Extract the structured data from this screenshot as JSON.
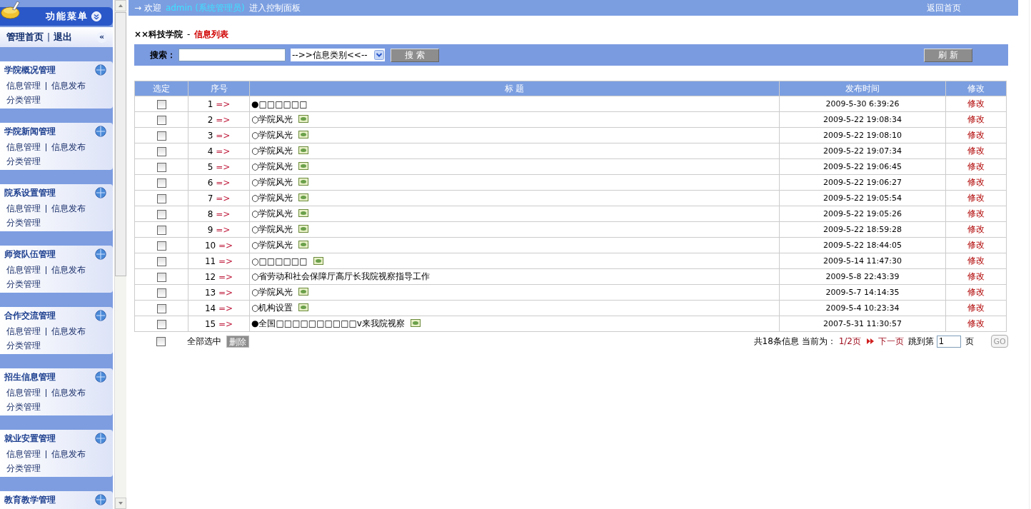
{
  "sidebar": {
    "title": "功能菜单",
    "home_link": "管理首页",
    "separator": "|",
    "logout_link": "退出",
    "collapse": "«",
    "groups": [
      {
        "title": "学院概况管理",
        "links": [
          "信息管理",
          "信息发布",
          "分类管理"
        ]
      },
      {
        "title": "学院新闻管理",
        "links": [
          "信息管理",
          "信息发布",
          "分类管理"
        ]
      },
      {
        "title": "院系设置管理",
        "links": [
          "信息管理",
          "信息发布",
          "分类管理"
        ]
      },
      {
        "title": "师资队伍管理",
        "links": [
          "信息管理",
          "信息发布",
          "分类管理"
        ]
      },
      {
        "title": "合作交流管理",
        "links": [
          "信息管理",
          "信息发布",
          "分类管理"
        ]
      },
      {
        "title": "招生信息管理",
        "links": [
          "信息管理",
          "信息发布",
          "分类管理"
        ]
      },
      {
        "title": "就业安置管理",
        "links": [
          "信息管理",
          "信息发布",
          "分类管理"
        ]
      },
      {
        "title": "教育教学管理"
      }
    ]
  },
  "top_bar": {
    "arrow": "→",
    "welcome": "欢迎",
    "user": "admin (系统管理员)",
    "suffix": "进入控制面板",
    "home_link": "返回首页"
  },
  "breadcrumb": {
    "site": "××科技学院",
    "separator": "-",
    "page": "信息列表"
  },
  "search": {
    "label": "搜索：",
    "category": "-->>信息类别<<--",
    "button": "搜 索",
    "refresh": "刷 新"
  },
  "table": {
    "columns": [
      "选定",
      "序号",
      "标 题",
      "发布时间",
      "修改"
    ],
    "rows": [
      {
        "checked": false,
        "index": "1",
        "arrow": "=>",
        "title": "●□□□□□□",
        "has_image": false,
        "date": "2009-5-30 6:39:26",
        "action": "修改"
      },
      {
        "checked": false,
        "index": "2",
        "arrow": "=>",
        "title": "○学院风光",
        "has_image": true,
        "date": "2009-5-22 19:08:34",
        "action": "修改"
      },
      {
        "checked": false,
        "index": "3",
        "arrow": "=>",
        "title": "○学院风光",
        "has_image": true,
        "date": "2009-5-22 19:08:10",
        "action": "修改"
      },
      {
        "checked": false,
        "index": "4",
        "arrow": "=>",
        "title": "○学院风光",
        "has_image": true,
        "date": "2009-5-22 19:07:34",
        "action": "修改"
      },
      {
        "checked": false,
        "index": "5",
        "arrow": "=>",
        "title": "○学院风光",
        "has_image": true,
        "date": "2009-5-22 19:06:45",
        "action": "修改"
      },
      {
        "checked": false,
        "index": "6",
        "arrow": "=>",
        "title": "○学院风光",
        "has_image": true,
        "date": "2009-5-22 19:06:27",
        "action": "修改"
      },
      {
        "checked": false,
        "index": "7",
        "arrow": "=>",
        "title": "○学院风光",
        "has_image": true,
        "date": "2009-5-22 19:05:54",
        "action": "修改"
      },
      {
        "checked": false,
        "index": "8",
        "arrow": "=>",
        "title": "○学院风光",
        "has_image": true,
        "date": "2009-5-22 19:05:26",
        "action": "修改"
      },
      {
        "checked": false,
        "index": "9",
        "arrow": "=>",
        "title": "○学院风光",
        "has_image": true,
        "date": "2009-5-22 18:59:28",
        "action": "修改"
      },
      {
        "checked": false,
        "index": "10",
        "arrow": "=>",
        "title": "○学院风光",
        "has_image": true,
        "date": "2009-5-22 18:44:05",
        "action": "修改"
      },
      {
        "checked": false,
        "index": "11",
        "arrow": "=>",
        "title": "○□□□□□□",
        "has_image": true,
        "date": "2009-5-14 11:47:30",
        "action": "修改"
      },
      {
        "checked": false,
        "index": "12",
        "arrow": "=>",
        "title": "○省劳动和社会保障厅高厅长我院视察指导工作",
        "has_image": false,
        "date": "2009-5-8 22:43:39",
        "action": "修改"
      },
      {
        "checked": false,
        "index": "13",
        "arrow": "=>",
        "title": "○学院风光",
        "has_image": true,
        "date": "2009-5-7 14:14:35",
        "action": "修改"
      },
      {
        "checked": false,
        "index": "14",
        "arrow": "=>",
        "title": "○机构设置",
        "has_image": true,
        "date": "2009-5-4 10:23:34",
        "action": "修改"
      },
      {
        "checked": false,
        "index": "15",
        "arrow": "=>",
        "title": "●全国□□□□□□□□□□v来我院视察",
        "has_image": true,
        "date": "2007-5-31 11:30:57",
        "action": "修改"
      }
    ]
  },
  "footer": {
    "select_all_checked": false,
    "select_all": "全部选中",
    "delete": "删除",
    "summary": "共18条信息 当前为：",
    "page": "1/2页",
    "next": "下一页",
    "jump_label": "跳到第",
    "page_input": "1",
    "page_unit": "页",
    "go": "GO"
  }
}
